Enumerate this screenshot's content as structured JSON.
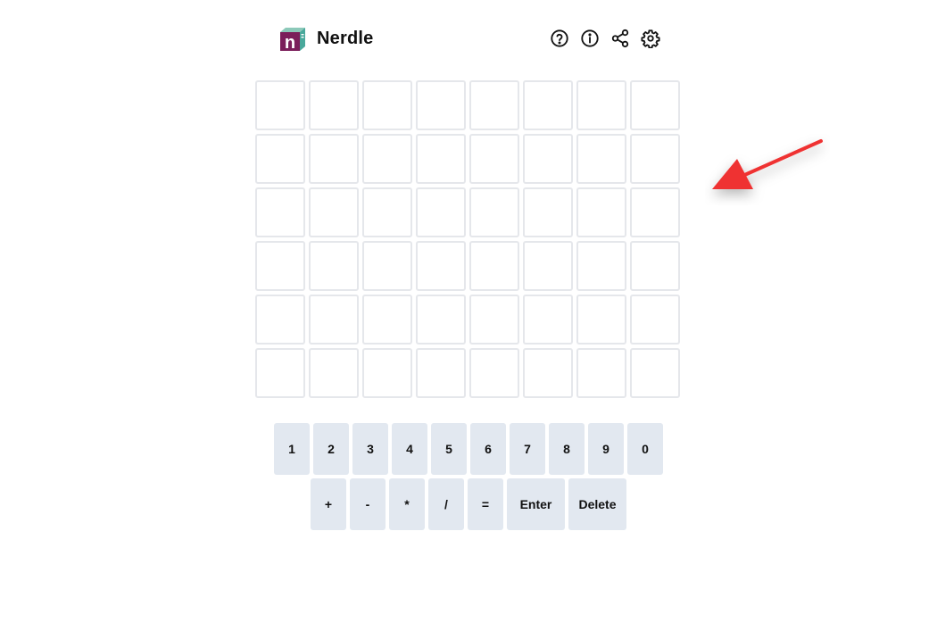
{
  "header": {
    "title": "Nerdle",
    "logo_letter": "n",
    "icons": [
      "help-icon",
      "info-icon",
      "share-icon",
      "settings-icon"
    ]
  },
  "board": {
    "rows": 6,
    "cols": 8
  },
  "keyboard": {
    "row1": [
      "1",
      "2",
      "3",
      "4",
      "5",
      "6",
      "7",
      "8",
      "9",
      "0"
    ],
    "row2": [
      "+",
      "-",
      "*",
      "/",
      "="
    ],
    "enter_label": "Enter",
    "delete_label": "Delete"
  },
  "colors": {
    "key_bg": "#e2e8f0",
    "tile_border": "#e5e7eb",
    "logo_primary": "#7b1e5a",
    "logo_secondary": "#3aa39a",
    "arrow": "#ef3131"
  }
}
